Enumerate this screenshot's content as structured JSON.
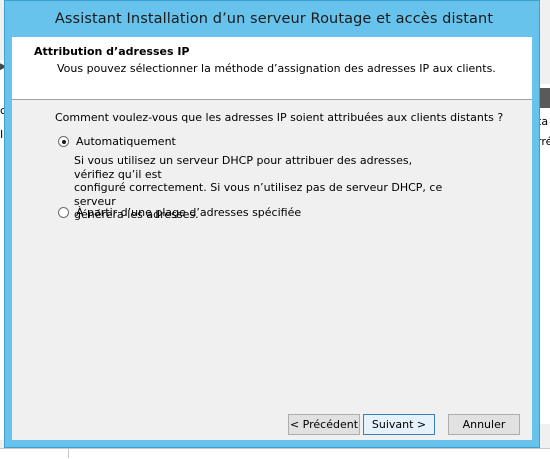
{
  "window": {
    "title": "Assistant Installation d’un serveur Routage et accès distant"
  },
  "header": {
    "title": "Attribution d’adresses IP",
    "subtitle": "Vous pouvez sélectionner la méthode d’assignation des adresses IP aux clients."
  },
  "body": {
    "question": "Comment voulez-vous que les adresses IP soient attribuées aux clients distants ?",
    "options": [
      {
        "label": "Automatiquement",
        "checked": true,
        "description_lines": [
          "Si vous utilisez un serveur DHCP pour attribuer des adresses, vérifiez qu’il est",
          "configuré correctement. Si vous n’utilisez pas de serveur DHCP, ce serveur",
          "générera les adresses."
        ]
      },
      {
        "label": "À partir d’une plage d’adresses spécifiée",
        "checked": false
      }
    ]
  },
  "buttons": {
    "previous": "< Précédent",
    "next": "Suivant >",
    "cancel": "Annuler"
  },
  "background": {
    "left_text_1": "c",
    "left_text_2": "I",
    "right_text_1": "ta",
    "right_text_2": "rré"
  }
}
